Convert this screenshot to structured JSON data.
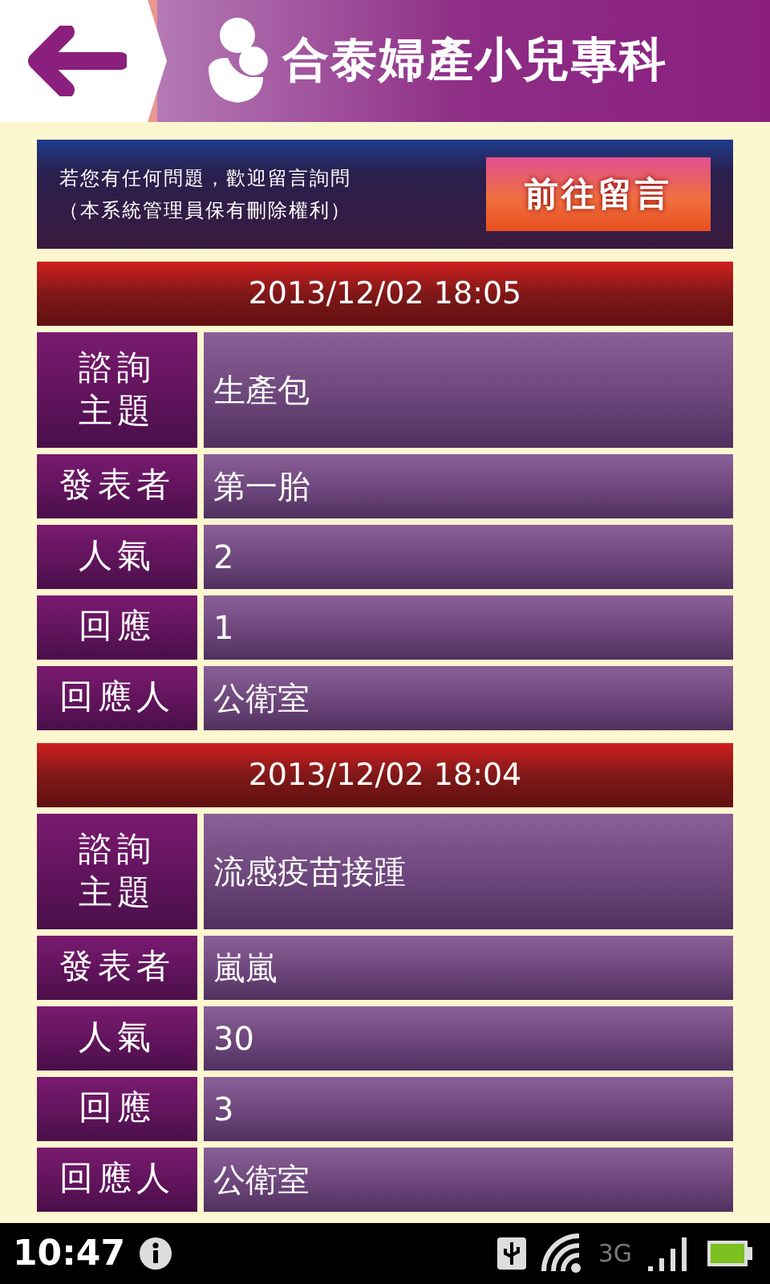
{
  "header": {
    "title": "合泰婦產小兒專科"
  },
  "banner": {
    "lines": [
      "若您有任何問題，歡迎留言詢問",
      "（本系統管理員保有刪除權利）"
    ],
    "button": "前往留言"
  },
  "posts": [
    {
      "date": "2013/12/02 18:05",
      "rows": [
        {
          "label": "諮詢主題",
          "value": "生產包",
          "kind": "tall"
        },
        {
          "label": "發表者",
          "value": "第一胎",
          "kind": "normal"
        },
        {
          "label": "人氣",
          "value": "2",
          "kind": "normal"
        },
        {
          "label": "回應",
          "value": "1",
          "kind": "normal"
        },
        {
          "label": "回應人",
          "value": "公衛室",
          "kind": "normal"
        }
      ]
    },
    {
      "date": "2013/12/02 18:04",
      "rows": [
        {
          "label": "諮詢主題",
          "value": "流感疫苗接踵",
          "kind": "tall"
        },
        {
          "label": "發表者",
          "value": "嵐嵐",
          "kind": "normal"
        },
        {
          "label": "人氣",
          "value": "30",
          "kind": "normal"
        },
        {
          "label": "回應",
          "value": "3",
          "kind": "normal"
        },
        {
          "label": "回應人",
          "value": "公衛室",
          "kind": "normal"
        }
      ]
    }
  ],
  "status_bar": {
    "time": "10:47",
    "network": "3G"
  }
}
